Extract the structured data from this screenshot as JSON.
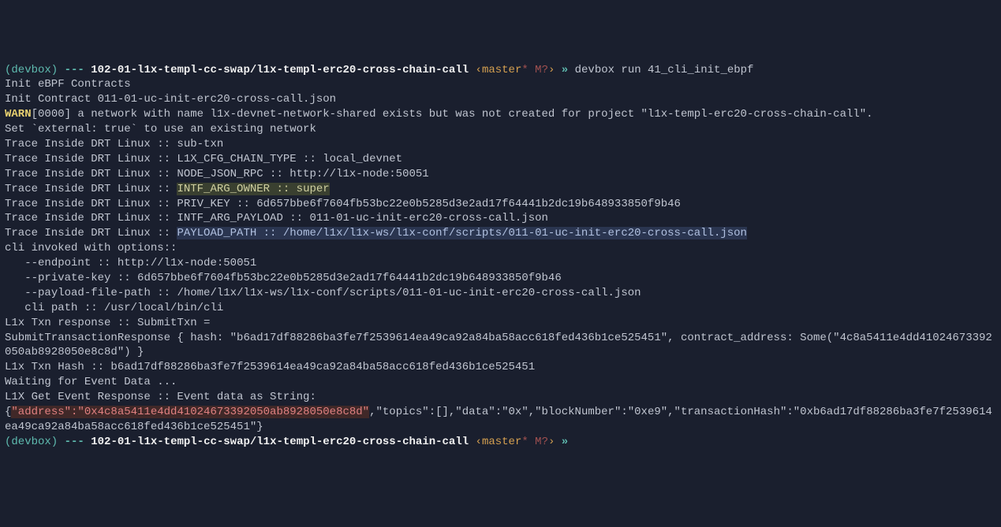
{
  "prompt1": {
    "env": "(devbox)",
    "dashes": "---",
    "path": "102-01-l1x-templ-cc-swap/l1x-templ-erc20-cross-chain-call",
    "branch_open": "‹",
    "branch_name": "master",
    "branch_marks": "* M?",
    "branch_close": "›",
    "prompt_sym": "»",
    "command": "devbox run 41_cli_init_ebpf"
  },
  "output": {
    "l1": "Init eBPF Contracts",
    "l2": "Init Contract 011-01-uc-init-erc20-cross-call.json",
    "warn_label": "WARN",
    "warn_rest": "[0000] a network with name l1x-devnet-network-shared exists but was not created for project \"l1x-templ-erc20-cross-chain-call\".",
    "l4": "Set `external: true` to use an existing network",
    "l5": "Trace Inside DRT Linux :: sub-txn",
    "l6": "Trace Inside DRT Linux :: L1X_CFG_CHAIN_TYPE :: local_devnet",
    "l7": "Trace Inside DRT Linux :: NODE_JSON_RPC :: http://l1x-node:50051",
    "l8a": "Trace Inside DRT Linux :: ",
    "l8b": "INTF_ARG_OWNER :: super",
    "l9": "Trace Inside DRT Linux :: PRIV_KEY :: 6d657bbe6f7604fb53bc22e0b5285d3e2ad17f64441b2dc19b648933850f9b46",
    "l10": "Trace Inside DRT Linux :: INTF_ARG_PAYLOAD :: 011-01-uc-init-erc20-cross-call.json",
    "l11a": "Trace Inside DRT Linux :: ",
    "l11b": "PAYLOAD_PATH :: /home/l1x/l1x-ws/l1x-conf/scripts/011-01-uc-init-erc20-cross-call.json",
    "l12": "cli invoked with options::",
    "l13": "   --endpoint :: http://l1x-node:50051",
    "l14": "   --private-key :: 6d657bbe6f7604fb53bc22e0b5285d3e2ad17f64441b2dc19b648933850f9b46",
    "l15": "   --payload-file-path :: /home/l1x/l1x-ws/l1x-conf/scripts/011-01-uc-init-erc20-cross-call.json",
    "l16": "   cli path :: /usr/local/bin/cli",
    "l17": "L1x Txn response :: SubmitTxn =",
    "l18": "SubmitTransactionResponse { hash: \"b6ad17df88286ba3fe7f2539614ea49ca92a84ba58acc618fed436b1ce525451\", contract_address: Some(\"4c8a5411e4dd41024673392050ab8928050e8c8d\") }",
    "l19": "L1x Txn Hash :: b6ad17df88286ba3fe7f2539614ea49ca92a84ba58acc618fed436b1ce525451",
    "l20": "Waiting for Event Data ...",
    "l21": "L1X Get Event Response :: Event data as String:",
    "l22a": "{",
    "l22b": "\"address\":\"0x4c8a5411e4dd41024673392050ab8928050e8c8d\"",
    "l22c": ",\"topics\":[],\"data\":\"0x\",\"blockNumber\":\"0xe9\",\"transactionHash\":\"0xb6ad17df88286ba3fe7f2539614ea49ca92a84ba58acc618fed436b1ce525451\"}"
  },
  "prompt2": {
    "env": "(devbox)",
    "dashes": "---",
    "path": "102-01-l1x-templ-cc-swap/l1x-templ-erc20-cross-chain-call",
    "branch_open": "‹",
    "branch_name": "master",
    "branch_marks": "* M?",
    "branch_close": "›",
    "prompt_sym": "»"
  }
}
